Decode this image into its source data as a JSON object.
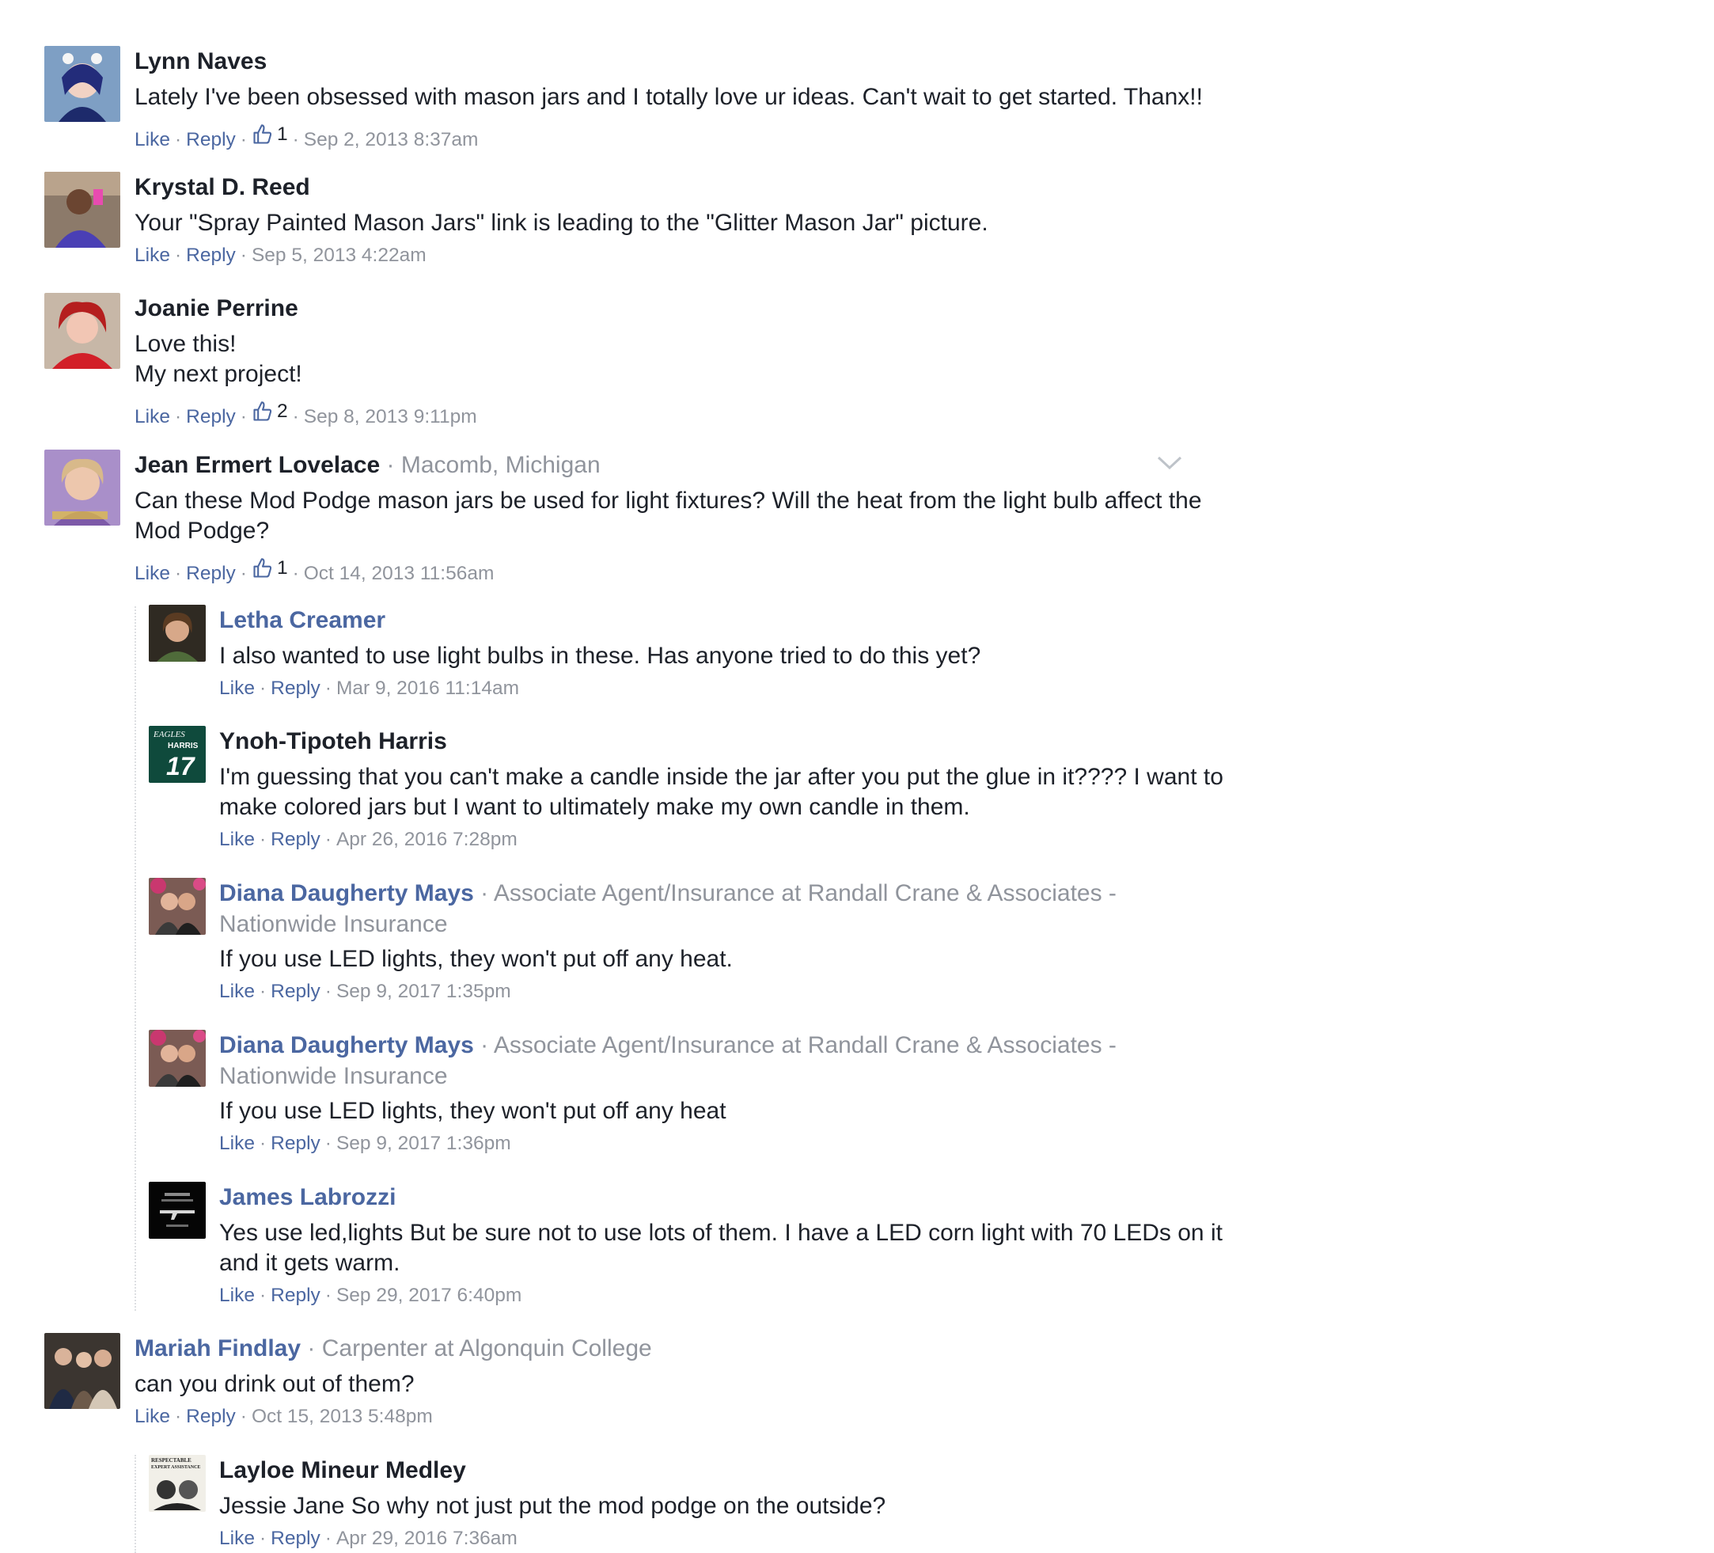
{
  "comments": [
    {
      "author": "Lynn Naves",
      "text": [
        "Lately I've been obsessed with mason jars and I totally love ur ideas. Can't wait to get started. Thanx!!"
      ],
      "like": "Like",
      "reply": "Reply",
      "likes": "1",
      "timestamp": "Sep 2, 2013 8:37am"
    },
    {
      "author": "Krystal D. Reed",
      "text": [
        "Your \"Spray Painted Mason Jars\" link is leading to the \"Glitter Mason Jar\" picture."
      ],
      "like": "Like",
      "reply": "Reply",
      "timestamp": "Sep 5, 2013 4:22am"
    },
    {
      "author": "Joanie Perrine",
      "text": [
        "Love this!",
        "My next project!"
      ],
      "like": "Like",
      "reply": "Reply",
      "likes": "2",
      "timestamp": "Sep 8, 2013 9:11pm"
    },
    {
      "author": "Jean Ermert Lovelace",
      "meta": "Macomb, Michigan",
      "text": [
        "Can these Mod Podge mason jars be used for light fixtures? Will the heat from the light bulb affect the",
        "Mod Podge?"
      ],
      "like": "Like",
      "reply": "Reply",
      "likes": "1",
      "timestamp": "Oct 14, 2013 11:56am",
      "replies": [
        {
          "author": "Letha Creamer",
          "text": [
            "I also wanted to use light bulbs in these. Has anyone tried to do this yet?"
          ],
          "like": "Like",
          "reply": "Reply",
          "timestamp": "Mar 9, 2016 11:14am"
        },
        {
          "author": "Ynoh-Tipoteh Harris",
          "avatar_text": [
            "EAGLES",
            "HARRIS",
            "17"
          ],
          "text": [
            "I'm guessing that you can't make a candle inside the jar after you put the glue in it???? I want to",
            "make colored jars but I want to ultimately make my own candle in them."
          ],
          "like": "Like",
          "reply": "Reply",
          "timestamp": "Apr 26, 2016 7:28pm"
        },
        {
          "author": "Diana Daugherty Mays",
          "meta": "Associate Agent/Insurance at Randall Crane & Associates -",
          "meta2": "Nationwide Insurance",
          "text": [
            "If you use LED lights, they won't put off any heat."
          ],
          "like": "Like",
          "reply": "Reply",
          "timestamp": "Sep 9, 2017 1:35pm"
        },
        {
          "author": "Diana Daugherty Mays",
          "meta": "Associate Agent/Insurance at Randall Crane & Associates -",
          "meta2": "Nationwide Insurance",
          "text": [
            "If you use LED lights, they won't put off any heat"
          ],
          "like": "Like",
          "reply": "Reply",
          "timestamp": "Sep 9, 2017 1:36pm"
        },
        {
          "author": "James Labrozzi",
          "text": [
            "Yes use led,lights But be sure not to use lots of them. I have a LED corn light with 70 LEDs on it",
            "and it gets warm."
          ],
          "like": "Like",
          "reply": "Reply",
          "timestamp": "Sep 29, 2017 6:40pm"
        }
      ]
    },
    {
      "author": "Mariah Findlay",
      "meta": "Carpenter at Algonquin College",
      "text": [
        "can you drink out of them?"
      ],
      "like": "Like",
      "reply": "Reply",
      "timestamp": "Oct 15, 2013 5:48pm",
      "replies": [
        {
          "author": "Layloe Mineur Medley",
          "avatar_text": [
            "RESPECTABLE",
            "EXPERT ASSISTANCE"
          ],
          "text": [
            "Jessie Jane So why not just put the mod podge on the outside?"
          ],
          "like": "Like",
          "reply": "Reply",
          "timestamp": "Apr 29, 2016 7:36am"
        }
      ]
    }
  ],
  "separator": "·",
  "colors": {
    "link": "#4b67a1",
    "meta": "#90949c",
    "text": "#1d2129"
  }
}
